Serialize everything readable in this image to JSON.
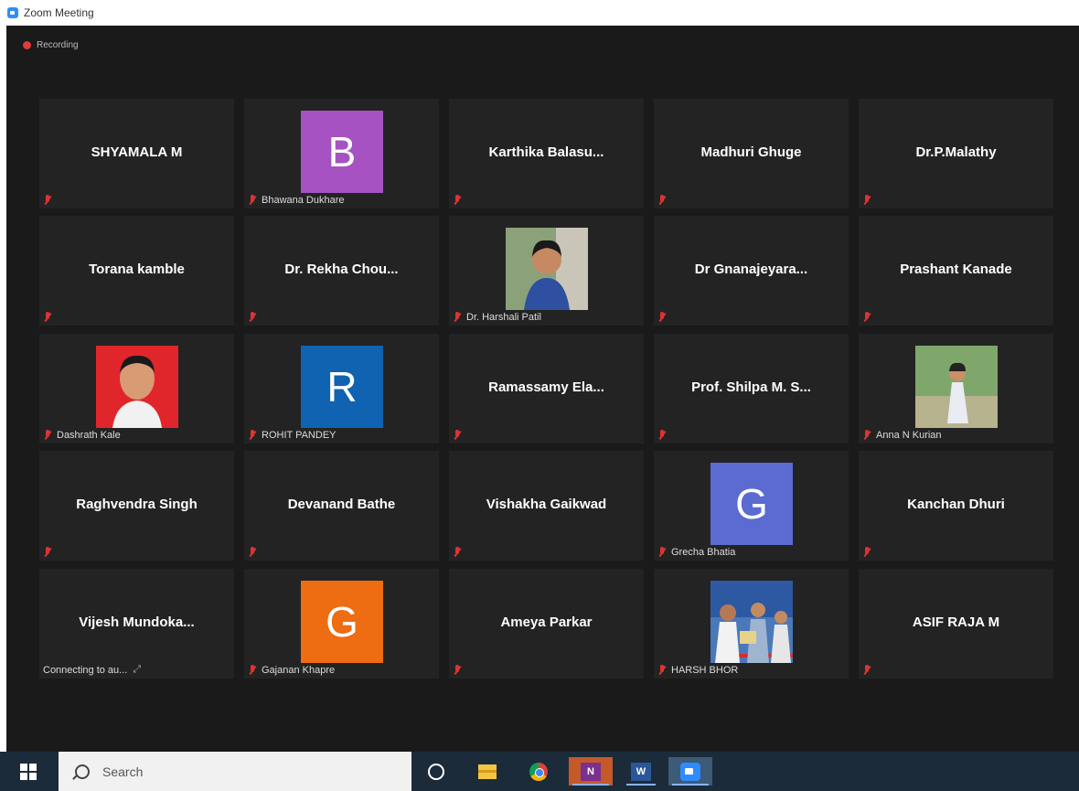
{
  "window": {
    "title": "Zoom Meeting"
  },
  "recording": {
    "label": "Recording",
    "color": "#e03a3a"
  },
  "participants": [
    {
      "name": "SHYAMALA M"
    },
    {
      "name": "Bhawana Dukhare",
      "avatar_letter": "B",
      "avatar_color": "#a652c2"
    },
    {
      "name": "Karthika  Balasu..."
    },
    {
      "name": "Madhuri Ghuge"
    },
    {
      "name": "Dr.P.Malathy"
    },
    {
      "name": "Torana kamble"
    },
    {
      "name": "Dr. Rekha Chou..."
    },
    {
      "name": "Dr. Harshali Patil",
      "photo": "woman-portrait"
    },
    {
      "name": "Dr  Gnanajeyara..."
    },
    {
      "name": "Prashant Kanade"
    },
    {
      "name": "Dashrath Kale",
      "photo": "man-portrait-red"
    },
    {
      "name": "ROHIT PANDEY",
      "avatar_letter": "R",
      "avatar_color": "#0f63b0"
    },
    {
      "name": "Ramassamy  Ela..."
    },
    {
      "name": "Prof.  Shilpa  M.  S..."
    },
    {
      "name": "Anna N Kurian",
      "photo": "person-outdoor"
    },
    {
      "name": "Raghvendra Singh"
    },
    {
      "name": "Devanand Bathe"
    },
    {
      "name": "Vishakha Gaikwad"
    },
    {
      "name": "Grecha Bhatia",
      "avatar_letter": "G",
      "avatar_color": "#5b6bd1"
    },
    {
      "name": "Kanchan Dhuri"
    },
    {
      "name": "Vijesh  Mundoka...",
      "status": "Connecting to au..."
    },
    {
      "name": "Gajanan Khapre",
      "avatar_letter": "G",
      "avatar_color": "#ee6c12"
    },
    {
      "name": "Ameya Parkar"
    },
    {
      "name": "HARSH BHOR",
      "photo": "award-photo"
    },
    {
      "name": "ASIF RAJA M"
    }
  ],
  "taskbar": {
    "search_placeholder": "Search",
    "apps": [
      {
        "name": "cortana-icon"
      },
      {
        "name": "file-explorer-icon"
      },
      {
        "name": "chrome-icon"
      },
      {
        "name": "onenote-icon",
        "letter": "N"
      },
      {
        "name": "word-icon",
        "letter": "W"
      },
      {
        "name": "zoom-icon"
      }
    ]
  }
}
